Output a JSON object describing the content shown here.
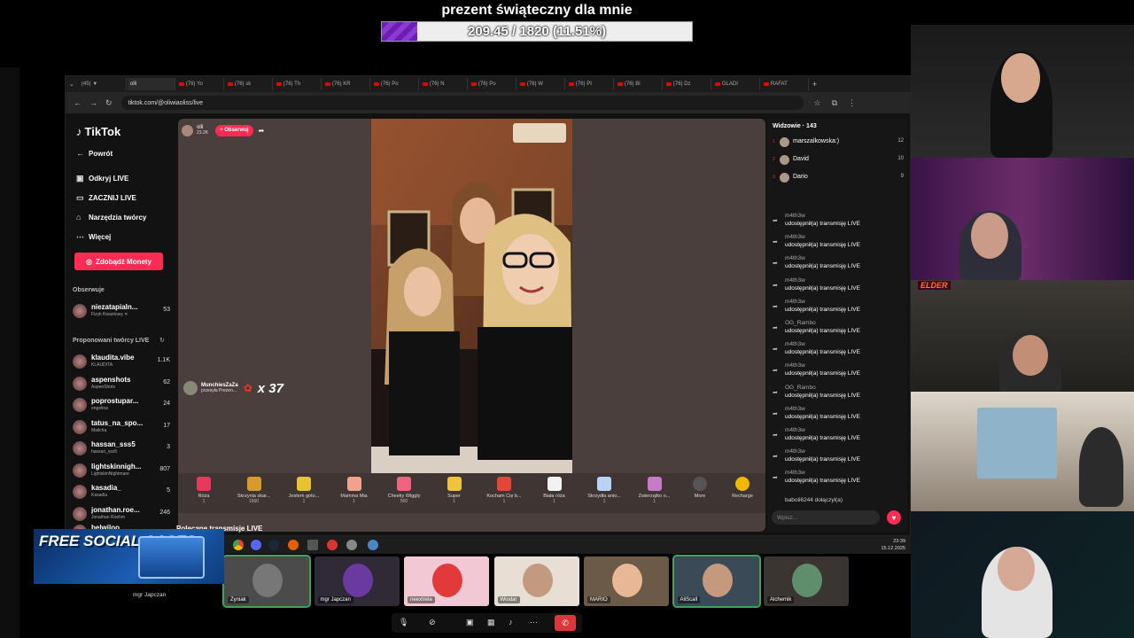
{
  "goal": {
    "title": "prezent świąteczny dla mnie",
    "progress_text": "209.45 / 1820 (11.51%)",
    "fraction": 0.1151
  },
  "browser": {
    "tabs": [
      "(45) ▼",
      "olli",
      "(76) Yo",
      "(76) sk",
      "(76) Th",
      "(76) KR",
      "(76) Po",
      "(76) N",
      "(76) Po",
      "(76) W",
      "(76) PI",
      "(76) Bi",
      "(76) Dz",
      "GLADI",
      "RAFAT"
    ],
    "url": "tiktok.com/@oliwiaoliss/live"
  },
  "sidebar": {
    "logo": "TikTok",
    "nav": [
      "Powrót",
      "Odkryj LIVE",
      "ZACZNIJ LIVE",
      "Narzędzia twórcy",
      "Więcej"
    ],
    "earn_button": "Zdobądź Monety",
    "following_header": "Obserwuje",
    "following": [
      {
        "name": "niezatapialn...",
        "sub": "Fizyk Kwantowy ✕",
        "count": "53"
      }
    ],
    "suggested_header": "Proponowani twórcy LIVE",
    "suggested": [
      {
        "name": "klaudita.vibe",
        "sub": "KLAUDITA",
        "count": "1.1K"
      },
      {
        "name": "aspenshots",
        "sub": "AspenShots",
        "count": "62"
      },
      {
        "name": "poprostupar...",
        "sub": "engelina",
        "count": "24"
      },
      {
        "name": "tatus_na_spo...",
        "sub": "Mailcha",
        "count": "17"
      },
      {
        "name": "hassan_sss5",
        "sub": "hassan_sss5",
        "count": "3"
      },
      {
        "name": "lightskinnigh...",
        "sub": "LightskinNightmare",
        "count": "807"
      },
      {
        "name": "kasadia_",
        "sub": "Kasadia",
        "count": "5"
      },
      {
        "name": "jonathan.roe...",
        "sub": "Jonathan Roehm",
        "count": "246"
      }
    ],
    "cut_item": "belwiloo"
  },
  "live": {
    "host": "olli",
    "likes": "23.2K",
    "follow_label": "+ Obserwuj",
    "gift_notice": {
      "sender": "MunchiesZaZa",
      "text": "przesyła Prezen...",
      "count": "x 37"
    },
    "gifts": [
      {
        "name": "Róża",
        "price": "1"
      },
      {
        "name": "Skrzynia skar...",
        "price": "1500"
      },
      {
        "name": "Jestem goto...",
        "price": "1"
      },
      {
        "name": "Mamma Mia",
        "price": "1"
      },
      {
        "name": "Cheeky Wiggly",
        "price": "500"
      },
      {
        "name": "Super",
        "price": "1"
      },
      {
        "name": "Kocham Cię b...",
        "price": "1"
      },
      {
        "name": "Biała róża",
        "price": "1"
      },
      {
        "name": "Skrzydła anio...",
        "price": "1"
      },
      {
        "name": "Zwierzątko o...",
        "price": "1"
      }
    ],
    "more_label": "More",
    "recharge_label": "Recharge",
    "recommended_label": "Polecane transmisje LIVE"
  },
  "chat": {
    "viewers_label": "Widzowie · 143",
    "top_viewers": [
      {
        "rank": "1",
        "name": "marszalkowska:)",
        "score": "12"
      },
      {
        "rank": "2",
        "name": "David",
        "score": "10"
      },
      {
        "rank": "3",
        "name": "Dario",
        "score": "9"
      }
    ],
    "messages": [
      {
        "user": "m4th3w",
        "text": "udostępnił(a) transmisję LIVE"
      },
      {
        "user": "m4th3w",
        "text": "udostępnił(a) transmisję LIVE"
      },
      {
        "user": "m4th3w",
        "text": "udostępnił(a) transmisję LIVE"
      },
      {
        "user": "m4th3w",
        "text": "udostępnił(a) transmisję LIVE"
      },
      {
        "user": "m4th3w",
        "text": "udostępnił(a) transmisję LIVE"
      },
      {
        "user": "OG_Rambo",
        "text": "udostępnił(a) transmisję LIVE"
      },
      {
        "user": "m4th3w",
        "text": "udostępnił(a) transmisję LIVE"
      },
      {
        "user": "m4th3w",
        "text": "udostępnił(a) transmisję LIVE"
      },
      {
        "user": "OG_Rambo",
        "text": "udostępnił(a) transmisję LIVE"
      },
      {
        "user": "m4th3w",
        "text": "udostępnił(a) transmisję LIVE"
      },
      {
        "user": "m4th3w",
        "text": "udostępnił(a) transmisję LIVE"
      },
      {
        "user": "m4th3w",
        "text": "udostępnił(a) transmisję LIVE"
      },
      {
        "user": "m4th3w",
        "text": "udostępnił(a) transmisję LIVE"
      }
    ],
    "join_line": "baboli6244  dołączył(a)",
    "input_placeholder": "Wpisz..."
  },
  "taskbar": {
    "time": "23:39",
    "date": "15.12.2025"
  },
  "discord": {
    "participants": [
      "Zyniak",
      "mgr Japczan",
      "neextrela",
      "Wiodar",
      "MARIO",
      "AliScall",
      "Alchemik"
    ],
    "self_label": "mgr Japczan"
  },
  "promo": {
    "text": "FREE SOCIAL CASES"
  },
  "cam_overlay": "ELDER"
}
